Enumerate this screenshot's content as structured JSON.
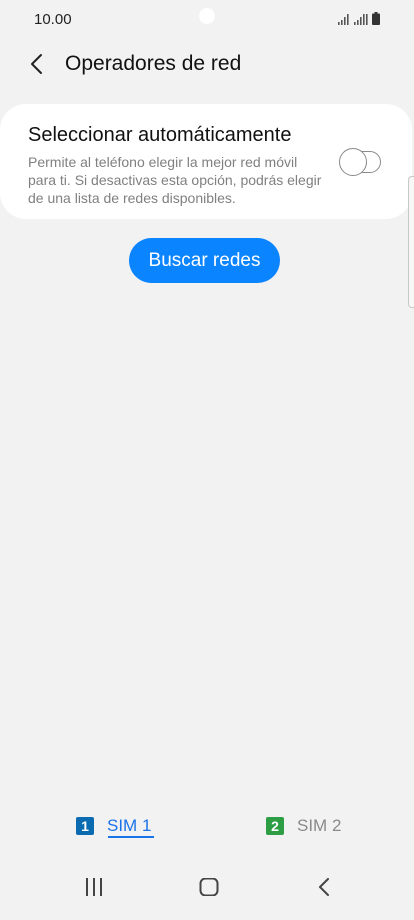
{
  "status_bar": {
    "time": "10.00"
  },
  "header": {
    "title": "Operadores de red"
  },
  "auto_select": {
    "title": "Seleccionar automáticamente",
    "description": "Permite al teléfono elegir la mejor red móvil para ti. Si desactivas esta opción, podrás elegir de una lista de redes disponibles.",
    "toggle_on": false
  },
  "search_button": {
    "label": "Buscar redes",
    "color": "#0a84ff"
  },
  "sim_tabs": [
    {
      "badge": "1",
      "label": "SIM 1",
      "badge_color": "#0b6bb0",
      "label_color": "#1a73e8",
      "selected": true
    },
    {
      "badge": "2",
      "label": "SIM 2",
      "badge_color": "#2e9e45",
      "label_color": "#8a8a8a",
      "selected": false
    }
  ],
  "nav_bar": {
    "icons": [
      "recent-apps-icon",
      "home-icon",
      "back-icon"
    ]
  }
}
